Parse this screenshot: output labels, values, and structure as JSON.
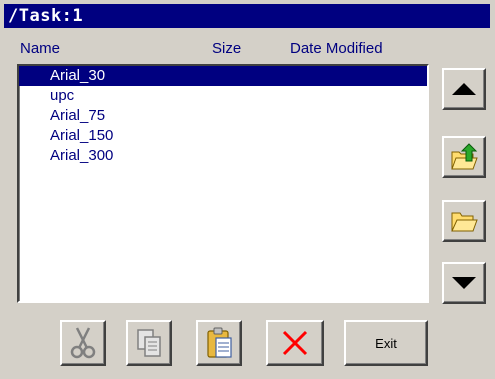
{
  "window": {
    "title": "/Task:1"
  },
  "columns": {
    "name": "Name",
    "size": "Size",
    "date_modified": "Date Modified"
  },
  "files": [
    {
      "name": "Arial_30",
      "selected": true
    },
    {
      "name": "upc",
      "selected": false
    },
    {
      "name": "Arial_75",
      "selected": false
    },
    {
      "name": "Arial_150",
      "selected": false
    },
    {
      "name": "Arial_300",
      "selected": false
    }
  ],
  "side_buttons": [
    {
      "icon": "triangle-up-icon"
    },
    {
      "icon": "folder-up-icon"
    },
    {
      "icon": "folder-icon"
    },
    {
      "icon": "triangle-down-icon"
    }
  ],
  "toolbar": {
    "cut_icon": "scissors-icon",
    "copy_icon": "copy-icon",
    "paste_icon": "clipboard-icon",
    "delete_icon": "delete-x-icon",
    "exit_label": "Exit"
  },
  "colors": {
    "title_bg": "#000080",
    "selection_bg": "#000080",
    "text_navy": "#000080",
    "face": "#d4d0c8",
    "delete_red": "#ff0000",
    "folder_yellow": "#ffdc6e",
    "arrow_green": "#2aa82a"
  }
}
